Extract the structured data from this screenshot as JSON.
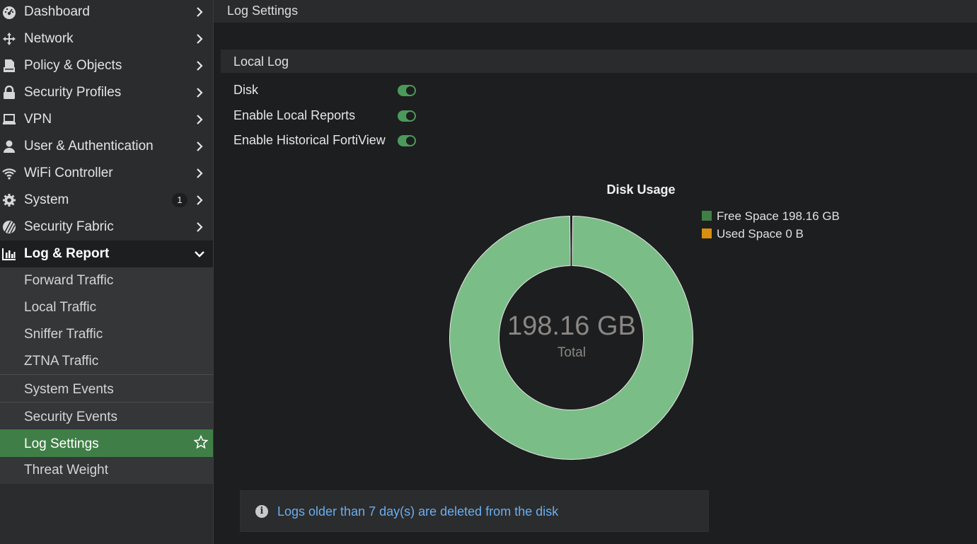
{
  "sidebar": {
    "items": [
      {
        "label": "Dashboard",
        "icon": "dashboard-icon"
      },
      {
        "label": "Network",
        "icon": "network-icon"
      },
      {
        "label": "Policy & Objects",
        "icon": "policy-icon"
      },
      {
        "label": "Security Profiles",
        "icon": "lock-icon"
      },
      {
        "label": "VPN",
        "icon": "laptop-icon"
      },
      {
        "label": "User & Authentication",
        "icon": "user-icon"
      },
      {
        "label": "WiFi Controller",
        "icon": "wifi-icon"
      },
      {
        "label": "System",
        "icon": "gear-icon",
        "badge": "1"
      },
      {
        "label": "Security Fabric",
        "icon": "fabric-icon"
      },
      {
        "label": "Log & Report",
        "icon": "chart-icon"
      }
    ],
    "sub_items": [
      {
        "label": "Forward Traffic"
      },
      {
        "label": "Local Traffic"
      },
      {
        "label": "Sniffer Traffic"
      },
      {
        "label": "ZTNA Traffic"
      },
      {
        "label": "System Events"
      },
      {
        "label": "Security Events"
      },
      {
        "label": "Log Settings"
      },
      {
        "label": "Threat Weight"
      }
    ]
  },
  "header": {
    "title": "Log Settings"
  },
  "local_log": {
    "title": "Local Log",
    "settings": [
      {
        "label": "Disk",
        "enabled": true
      },
      {
        "label": "Enable Local Reports",
        "enabled": true
      },
      {
        "label": "Enable Historical FortiView",
        "enabled": true
      }
    ]
  },
  "chart_data": {
    "type": "pie",
    "title": "Disk Usage",
    "series": [
      {
        "name": "Free Space 198.16 GB",
        "value": 198.16,
        "color": "#7bbd87",
        "legend_color": "#3f7f47"
      },
      {
        "name": "Used Space 0 B",
        "value": 0,
        "color": "#d88f10",
        "legend_color": "#d88f10"
      }
    ],
    "center_value": "198.16 GB",
    "center_label": "Total",
    "legend_position": "top-right"
  },
  "info": {
    "message": "Logs older than 7 day(s) are deleted from the disk"
  }
}
